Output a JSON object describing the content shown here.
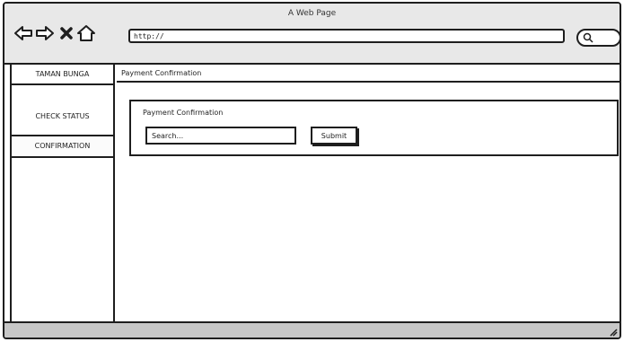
{
  "window": {
    "title": "A Web Page"
  },
  "browser": {
    "url": "http://"
  },
  "icons": {
    "back": "arrow-left-icon",
    "forward": "arrow-right-icon",
    "stop": "close-icon",
    "home": "home-icon",
    "search": "search-icon",
    "resize": "resize-grip-icon"
  },
  "sidebar": {
    "brand": "TAMAN BUNGA",
    "items": [
      {
        "label": "CHECK STATUS"
      },
      {
        "label": "CONFIRMATION"
      }
    ]
  },
  "header": {
    "breadcrumb": "Payment Confirmation"
  },
  "main": {
    "panel_title": "Payment Confirmation",
    "search_placeholder": "Search...",
    "submit_label": "Submit"
  }
}
